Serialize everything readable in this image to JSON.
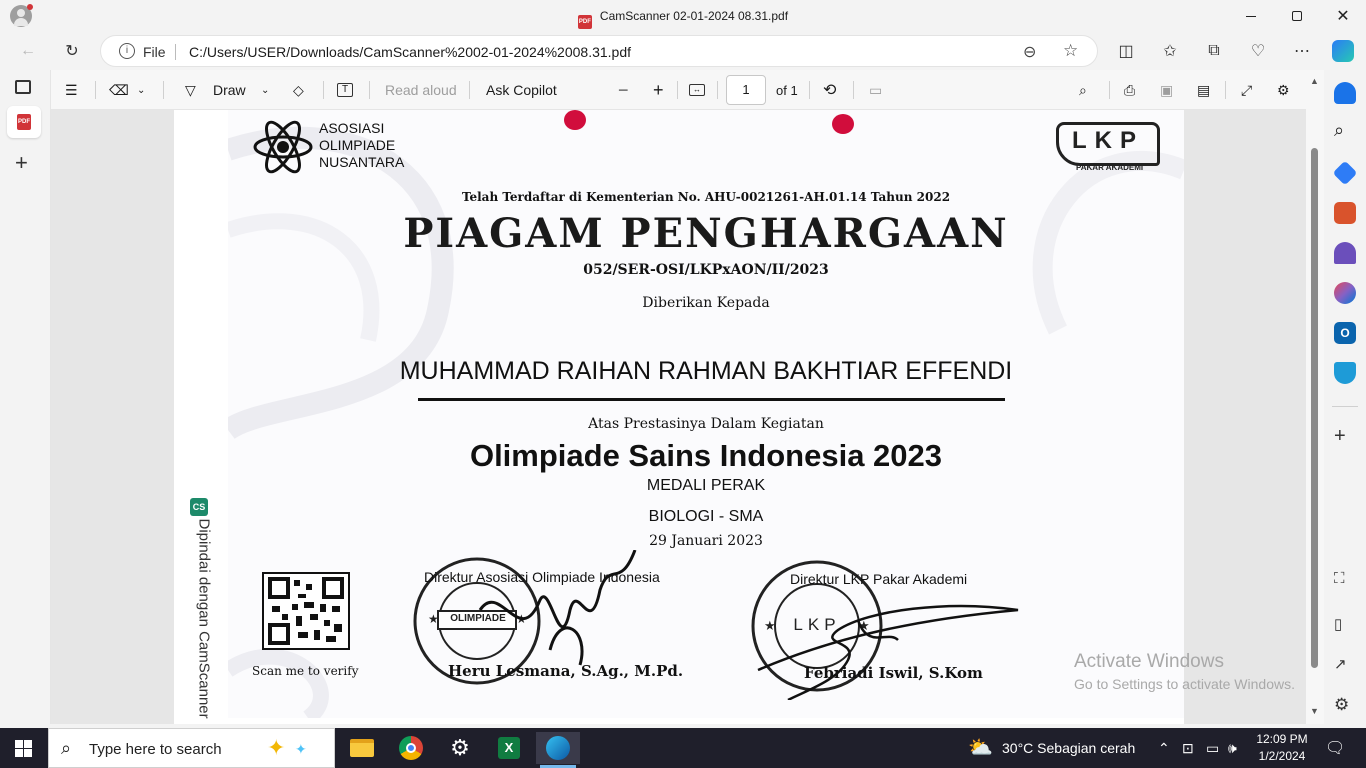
{
  "window": {
    "title": "CamScanner 02-01-2024 08.31.pdf",
    "minimize_icon": "minimize-icon",
    "maximize_icon": "restore-icon",
    "close_icon": "close-icon"
  },
  "address_bar": {
    "file_label": "File",
    "url": "C:/Users/USER/Downloads/CamScanner%2002-01-2024%2008.31.pdf"
  },
  "pdf_toolbar": {
    "draw_label": "Draw",
    "read_aloud_label": "Read aloud",
    "ask_copilot_label": "Ask Copilot",
    "zoom_out": "−",
    "zoom_in": "+",
    "page_current": "1",
    "page_total": "of 1"
  },
  "certificate": {
    "org_line1": "ASOSIASI",
    "org_line2": "OLIMPIADE",
    "org_line3": "NUSANTARA",
    "lkp_logo": "LKP",
    "lkp_sub": "PAKAR AKADEMI",
    "registration": "Telah Terdaftar di Kementerian No. AHU-0021261-AH.01.14 Tahun 2022",
    "heading": "PIAGAM PENGHARGAAN",
    "number": "052/SER-OSI/LKPxAON/II/2023",
    "given_to": "Diberikan Kepada",
    "recipient": "MUHAMMAD RAIHAN RAHMAN BAKHTIAR EFFENDI",
    "for_achievement": "Atas Prestasinya Dalam Kegiatan",
    "event": "Olimpiade Sains Indonesia 2023",
    "medal": "MEDALI PERAK",
    "subject": "BIOLOGI - SMA",
    "date": "29 Januari 2023",
    "qr_caption": "Scan me to verify",
    "signer1_title": "Direktur Asosiasi Olimpiade Indonesia",
    "signer1_name": "Heru Lesmana, S.Ag., M.Pd.",
    "signer2_title": "Direktur LKP Pakar Akademi",
    "signer2_name": "Febriadi Iswil, S.Kom",
    "stamp1_text": "OLIMPIADE",
    "stamp2_text": "LKP",
    "camscanner_badge": "CS",
    "camscanner_watermark": "Dipindai dengan CamScanner"
  },
  "activate_windows": {
    "title": "Activate Windows",
    "subtitle": "Go to Settings to activate Windows."
  },
  "taskbar": {
    "search_placeholder": "Type here to search",
    "weather": "30°C  Sebagian cerah",
    "time": "12:09 PM",
    "date": "1/2/2024"
  },
  "colors": {
    "accent": "#0067c0",
    "excel": "#107c41",
    "chrome_red": "#db4437",
    "edge": "#0c8dd6"
  }
}
